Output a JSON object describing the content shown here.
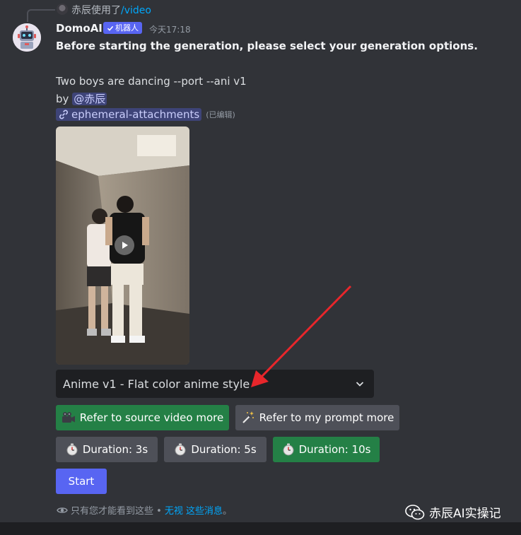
{
  "reply": {
    "username": "赤辰",
    "action": "使用了",
    "command": "/video"
  },
  "message": {
    "author": "DomoAI",
    "bot_badge": "机器人",
    "timestamp": "今天17:18",
    "instruction": "Before starting the generation, please select your generation options.",
    "prompt": "Two boys are dancing --port --ani v1",
    "by_label": "by",
    "mention": "@赤辰",
    "attachment_link": "ephemeral-attachments",
    "edited": "(已编辑)"
  },
  "style_select": {
    "value": "Anime v1 - Flat color anime style"
  },
  "reference_buttons": [
    {
      "label": "Refer to source video more",
      "style": "green",
      "icon": "movie-camera-icon"
    },
    {
      "label": "Refer to my prompt more",
      "style": "gray",
      "icon": "magic-wand-icon"
    }
  ],
  "duration_buttons": [
    {
      "label": "Duration: 3s",
      "style": "gray",
      "icon": "stopwatch-icon"
    },
    {
      "label": "Duration: 5s",
      "style": "gray",
      "icon": "stopwatch-icon"
    },
    {
      "label": "Duration: 10s",
      "style": "green",
      "icon": "stopwatch-icon"
    }
  ],
  "start_button": {
    "label": "Start"
  },
  "ephemeral_note": {
    "text": "只有您才能看到这些 •",
    "dismiss_link": "无视 这些消息",
    "suffix": "。"
  },
  "watermark": {
    "text": "赤辰AI实操记"
  },
  "colors": {
    "background": "#313338",
    "blurple": "#5865f2",
    "green": "#248046",
    "gray_button": "#4e5058",
    "link": "#00a8fc",
    "arrow": "#e8262b"
  }
}
